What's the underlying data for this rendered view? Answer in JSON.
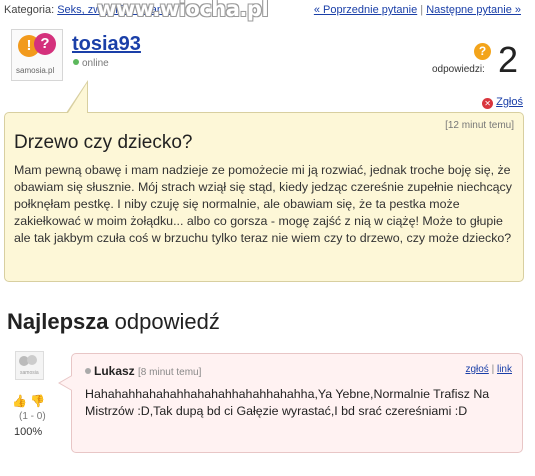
{
  "topbar": {
    "category_label": "Kategoria:",
    "category_link": "Seks, związki i romanse",
    "nav_prev": "« Poprzednie pytanie",
    "nav_sep": "|",
    "nav_next": "Następne pytanie »",
    "watermark": "www.wiocha.pl"
  },
  "asker": {
    "avatar_brand": "samosia.pl",
    "username": "tosia93",
    "status": "online",
    "answers_label": "odpowiedzi:",
    "answers_count": "2"
  },
  "report_label": "Zgłoś",
  "question": {
    "time": "[12 minut temu]",
    "title": "Drzewo czy dziecko?",
    "body": "Mam pewną obawę i mam nadzieje ze pomożecie mi ją rozwiać, jednak troche boję się, że obawiam się słusznie. Mój strach wziął się stąd, kiedy jedząc czereśnie zupełnie niechcący połknęłam pestkę. I niby czuję się normalnie, ale obawiam się, że ta pestka może zakiełkować w moim żołądku... albo co gorsza - mogę zajść z nią w ciążę! Może to głupie ale tak jakbym czuła coś w brzuchu tylko teraz nie wiem czy to drzewo, czy może dziecko?"
  },
  "best_answer": {
    "heading_bold": "Najlepsza",
    "heading_rest": "odpowiedź",
    "username": "Lukasz",
    "time": "[8 minut temu]",
    "report_link": "zgłoś",
    "sep": "|",
    "link_link": "link",
    "body": "Hahahahhahahahhahahahhahahhahahha,Ya Yebne,Normalnie Trafisz Na Mistrzów :D,Tak dupą bd ci Gałęzie wyrastać,I bd srać czereśniami :D",
    "votes": "(1 - 0)",
    "percent": "100%"
  },
  "icons": {
    "report": "close-circle-icon",
    "thumb_up": "thumb-up-icon",
    "thumb_down": "thumb-down-icon",
    "answers": "question-bubble-icon"
  },
  "colors": {
    "question_bg": "#fdf7d7",
    "answer_bg": "#fff2f2",
    "link": "#1a3fa8",
    "answers_icon": "#f3a41b"
  }
}
